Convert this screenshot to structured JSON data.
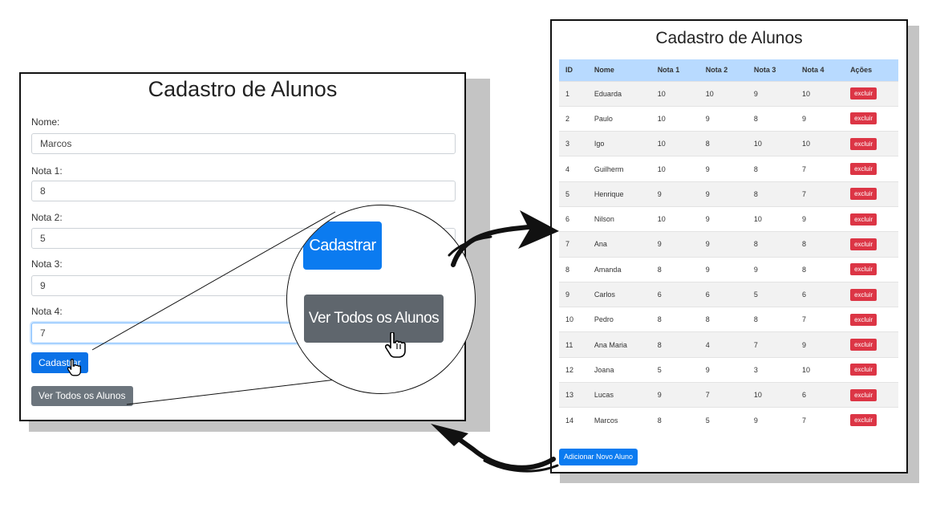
{
  "form": {
    "title": "Cadastro de Alunos",
    "fields": [
      {
        "label": "Nome:",
        "value": "Marcos"
      },
      {
        "label": "Nota 1:",
        "value": "8"
      },
      {
        "label": "Nota 2:",
        "value": "5"
      },
      {
        "label": "Nota 3:",
        "value": "9"
      },
      {
        "label": "Nota 4:",
        "value": "7"
      }
    ],
    "submit_label": "Cadastrar",
    "view_all_label": "Ver Todos os Alunos"
  },
  "zoom": {
    "submit_label": "Cadastrar",
    "view_all_label": "Ver Todos os Alunos"
  },
  "table_page": {
    "title": "Cadastro de Alunos",
    "columns": [
      "ID",
      "Nome",
      "Nota 1",
      "Nota 2",
      "Nota 3",
      "Nota 4",
      "Ações"
    ],
    "rows": [
      [
        "1",
        "Eduarda",
        "10",
        "10",
        "9",
        "10"
      ],
      [
        "2",
        "Paulo",
        "10",
        "9",
        "8",
        "9"
      ],
      [
        "3",
        "Igo",
        "10",
        "8",
        "10",
        "10"
      ],
      [
        "4",
        "Guilherm",
        "10",
        "9",
        "8",
        "7"
      ],
      [
        "5",
        "Henrique",
        "9",
        "9",
        "8",
        "7"
      ],
      [
        "6",
        "Nilson",
        "10",
        "9",
        "10",
        "9"
      ],
      [
        "7",
        "Ana",
        "9",
        "9",
        "8",
        "8"
      ],
      [
        "8",
        "Amanda",
        "8",
        "9",
        "9",
        "8"
      ],
      [
        "9",
        "Carlos",
        "6",
        "6",
        "5",
        "6"
      ],
      [
        "10",
        "Pedro",
        "8",
        "8",
        "8",
        "7"
      ],
      [
        "11",
        "Ana Maria",
        "8",
        "4",
        "7",
        "9"
      ],
      [
        "12",
        "Joana",
        "5",
        "9",
        "3",
        "10"
      ],
      [
        "13",
        "Lucas",
        "9",
        "7",
        "10",
        "6"
      ],
      [
        "14",
        "Marcos",
        "8",
        "5",
        "9",
        "7"
      ]
    ],
    "delete_label": "excluir",
    "add_label": "Adicionar Novo Aluno"
  },
  "colors": {
    "primary": "#0b7bf0",
    "secondary": "#6c757d",
    "danger": "#dc3545",
    "table_header": "#b8daff"
  },
  "icons": [
    "hand-pointer-icon",
    "arrow-right-icon",
    "arrow-left-icon"
  ]
}
